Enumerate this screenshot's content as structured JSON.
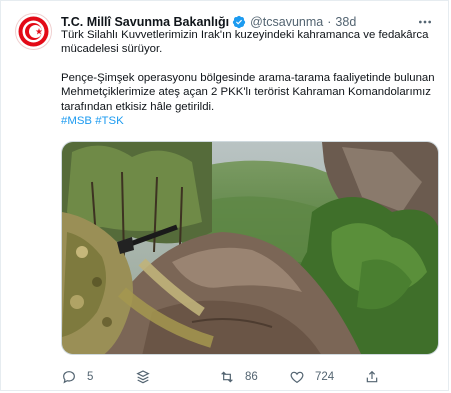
{
  "tweet": {
    "author_name": "T.C. Millî Savunma Bakanlığı",
    "handle": "@tcsavunma",
    "separator": "·",
    "time": "38d",
    "paragraph1": "Türk Silahlı Kuvvetlerimizin Irak'ın kuzeyindeki kahramanca ve fedakârca mücadelesi sürüyor.",
    "paragraph2": "Pençe-Şimşek operasyonu bölgesinde arama-tarama faaliyetinde bulunan Mehmetçiklerimize ateş açan 2 PKK'lı terörist Kahraman Komandolarımız tarafından etkisiz hâle getirildi.",
    "hashtags": [
      "#MSB",
      "#TSK"
    ]
  },
  "actions": {
    "reply_count": "5",
    "retweet_count": "86",
    "like_count": "724"
  },
  "colors": {
    "accent": "#1d9bf0",
    "muted": "#536471",
    "logo_red": "#e30a17"
  },
  "icons": {
    "verified": "verified-badge-icon",
    "more": "more-options-icon",
    "reply": "reply-icon",
    "stack": "stack-icon",
    "retweet": "retweet-icon",
    "like": "heart-icon",
    "share": "share-icon"
  }
}
